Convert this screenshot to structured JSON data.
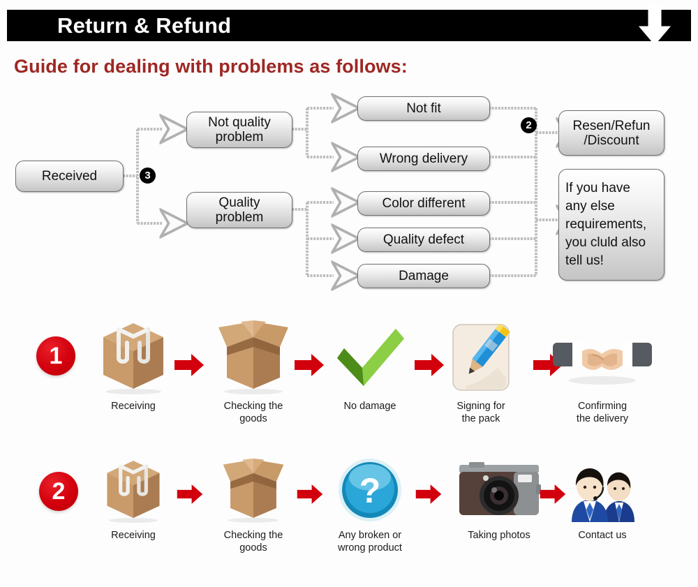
{
  "header": {
    "title": "Return & Refund",
    "down_arrow_icon": "down-arrow-icon",
    "bar_color": "#000000",
    "text_color": "#ffffff"
  },
  "guide": {
    "heading": "Guide for dealing with problems as follows:",
    "heading_color": "#9e2723"
  },
  "flowchart": {
    "nodes": {
      "received": "Received",
      "not_quality_problem": "Not quality\nproblem",
      "quality_problem": "Quality\nproblem",
      "not_fit": "Not fit",
      "wrong_delivery": "Wrong delivery",
      "color_different": "Color different",
      "quality_defect": "Quality defect",
      "damage": "Damage",
      "resend_refund_discount": "Resen/Refun\n/Discount",
      "any_else": "If you have any else requirements, you cluld also tell us!"
    },
    "node_labels": {
      "not_quality_problem_l1": "Not quality",
      "not_quality_problem_l2": "problem",
      "quality_problem_l1": "Quality",
      "quality_problem_l2": "problem",
      "resend_l1": "Resen/Refun",
      "resend_l2": "/Discount",
      "any_else_l1": "If you have",
      "any_else_l2": "any else",
      "any_else_l3": "requirements,",
      "any_else_l4": "you cluld also",
      "any_else_l5": "tell us!"
    },
    "badges": {
      "branch_three": "3",
      "branch_two": "2"
    },
    "connector_color": "#b4b4b4",
    "node_border_color": "#6f6f6f"
  },
  "process_rows": [
    {
      "badge": "1",
      "badge_color": "#d2000c",
      "steps": [
        {
          "icon": "sealed-box-icon",
          "caption_l1": "Receiving",
          "caption_l2": ""
        },
        {
          "icon": "open-box-icon",
          "caption_l1": "Checking the",
          "caption_l2": "goods"
        },
        {
          "icon": "green-check-icon",
          "caption_l1": "No damage",
          "caption_l2": ""
        },
        {
          "icon": "pencil-sign-icon",
          "caption_l1": "Signing for",
          "caption_l2": "the pack"
        },
        {
          "icon": "handshake-icon",
          "caption_l1": "Confirming",
          "caption_l2": "the delivery"
        }
      ]
    },
    {
      "badge": "2",
      "badge_color": "#d2000c",
      "steps": [
        {
          "icon": "sealed-box-icon",
          "caption_l1": "Receiving",
          "caption_l2": ""
        },
        {
          "icon": "open-box-icon",
          "caption_l1": "Checking the",
          "caption_l2": "goods"
        },
        {
          "icon": "question-mark-icon",
          "caption_l1": "Any broken or",
          "caption_l2": "wrong product"
        },
        {
          "icon": "camera-icon",
          "caption_l1": "Taking photos",
          "caption_l2": ""
        },
        {
          "icon": "support-agents-icon",
          "caption_l1": "Contact us",
          "caption_l2": ""
        }
      ]
    }
  ],
  "colors": {
    "red_arrow": "#d2000c",
    "box_fill_top": "#ffffff",
    "box_fill_bottom": "#c4c4c4"
  }
}
